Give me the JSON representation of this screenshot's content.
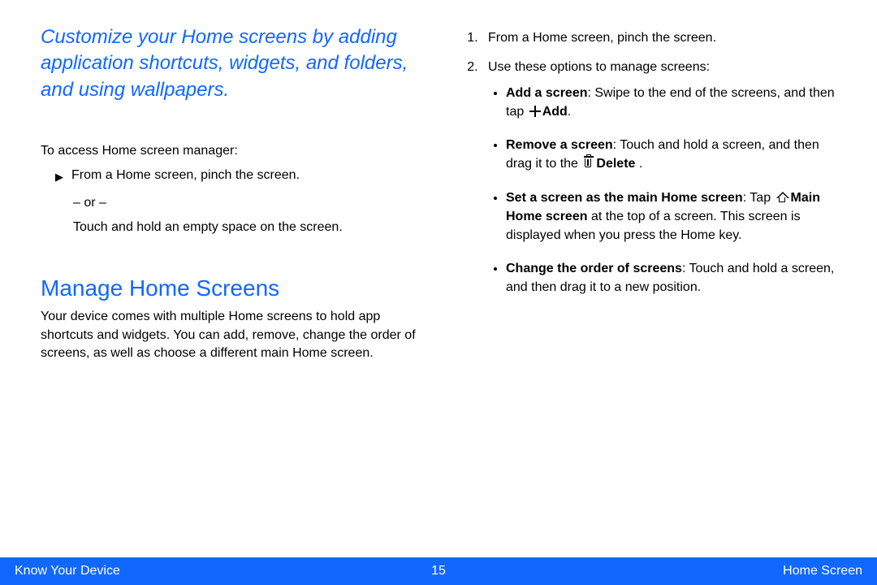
{
  "colors": {
    "accent": "#1068ff"
  },
  "left": {
    "lead": "Customize your Home screens by adding application shortcuts, widgets, and folders, and using wallpapers.",
    "access_label": "To access Home screen manager:",
    "arrow_text": "From a Home screen, pinch the screen.",
    "or_text": "– or –",
    "alt_text": "Touch and hold an empty space on the screen.",
    "h2": "Manage Home Screens",
    "body": "Your device comes with multiple Home screens to hold app shortcuts and widgets. You can add, remove, change the order of screens, as well as choose a different main Home screen."
  },
  "right": {
    "step1": "From a Home screen, pinch the screen.",
    "step2": "Use these options to manage screens:",
    "b1": {
      "label": "Add a screen",
      "pre": ": Swipe to the end of the screens, and then tap ",
      "tail": "Add",
      "after": "."
    },
    "b2": {
      "label": "Remove a screen",
      "pre": ": Touch and hold a screen, and then drag it to the ",
      "tail": "Delete",
      "after": " ."
    },
    "b3": {
      "label": "Set a screen as the main Home screen",
      "pre": ": Tap ",
      "tail": "Main Home screen",
      "after": " at the top of a screen. This screen is displayed when you press the Home key."
    },
    "b4": {
      "label": "Change the order of screens",
      "text": ": Touch and hold a screen, and then drag it to a new position."
    }
  },
  "footer": {
    "left": "Know Your Device",
    "page": "15",
    "right": "Home Screen"
  }
}
